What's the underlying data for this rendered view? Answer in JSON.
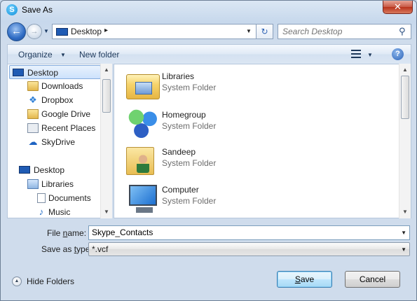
{
  "window": {
    "title": "Save As",
    "close_glyph": "✕"
  },
  "address": {
    "path_root": "Desktop",
    "path_separator": "▸"
  },
  "search": {
    "placeholder": "Search Desktop"
  },
  "toolbar": {
    "organize_label": "Organize",
    "new_folder_label": "New folder"
  },
  "sidebar": {
    "items": [
      {
        "label": "Desktop",
        "icon": "desktop-icon",
        "selected": true
      },
      {
        "label": "Downloads",
        "icon": "downloads-folder-icon"
      },
      {
        "label": "Dropbox",
        "icon": "dropbox-icon"
      },
      {
        "label": "Google Drive",
        "icon": "google-drive-icon"
      },
      {
        "label": "Recent Places",
        "icon": "recent-places-icon"
      },
      {
        "label": "SkyDrive",
        "icon": "skydrive-icon"
      },
      {
        "label": "Desktop",
        "icon": "desktop-icon"
      },
      {
        "label": "Libraries",
        "icon": "libraries-icon"
      },
      {
        "label": "Documents",
        "icon": "documents-icon"
      },
      {
        "label": "Music",
        "icon": "music-icon"
      }
    ]
  },
  "content": {
    "items": [
      {
        "name": "Libraries",
        "type": "System Folder",
        "icon": "libraries-icon"
      },
      {
        "name": "Homegroup",
        "type": "System Folder",
        "icon": "homegroup-icon"
      },
      {
        "name": "Sandeep",
        "type": "System Folder",
        "icon": "user-folder-icon"
      },
      {
        "name": "Computer",
        "type": "System Folder",
        "icon": "computer-icon"
      }
    ]
  },
  "form": {
    "file_name_label_pre": "File ",
    "file_name_label_accel": "n",
    "file_name_label_post": "ame:",
    "file_name_value": "Skype_Contacts",
    "save_type_label_pre": "Save as ",
    "save_type_label_accel": "t",
    "save_type_label_post": "ype:",
    "save_type_value": "*.vcf"
  },
  "footer": {
    "hide_folders_label": "Hide Folders",
    "save_label_accel": "S",
    "save_label_post": "ave",
    "cancel_label": "Cancel"
  },
  "colors": {
    "selection_border": "#84acdd",
    "title_gradient_top": "#dbe7f4",
    "close_button": "#c75a46",
    "primary_button": "#bee6fd"
  }
}
